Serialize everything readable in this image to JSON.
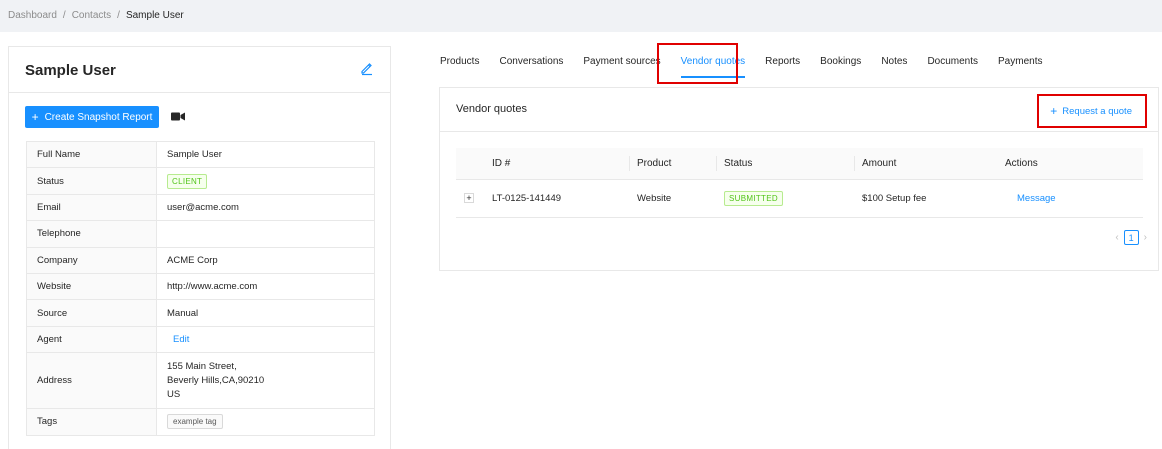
{
  "breadcrumb": {
    "items": [
      "Dashboard",
      "Contacts"
    ],
    "current": "Sample User",
    "separator": "/"
  },
  "profile": {
    "name": "Sample User",
    "snapshot_button": "Create Snapshot Report",
    "rows": {
      "full_name": {
        "label": "Full Name",
        "value": "Sample User"
      },
      "status": {
        "label": "Status",
        "value": "CLIENT"
      },
      "email": {
        "label": "Email",
        "value": "user@acme.com"
      },
      "telephone": {
        "label": "Telephone",
        "value": ""
      },
      "company": {
        "label": "Company",
        "value": "ACME Corp"
      },
      "website": {
        "label": "Website",
        "value": "http://www.acme.com"
      },
      "source": {
        "label": "Source",
        "value": "Manual"
      },
      "agent": {
        "label": "Agent",
        "value": "Edit"
      },
      "address": {
        "label": "Address",
        "line1": "155 Main Street,",
        "line2": "Beverly Hills,CA,90210",
        "line3": "US"
      },
      "tags": {
        "label": "Tags",
        "value": "example tag"
      }
    }
  },
  "tabs": [
    {
      "label": "Products",
      "active": false
    },
    {
      "label": "Conversations",
      "active": false
    },
    {
      "label": "Payment sources",
      "active": false
    },
    {
      "label": "Vendor quotes",
      "active": true
    },
    {
      "label": "Reports",
      "active": false
    },
    {
      "label": "Bookings",
      "active": false
    },
    {
      "label": "Notes",
      "active": false
    },
    {
      "label": "Documents",
      "active": false
    },
    {
      "label": "Payments",
      "active": false
    }
  ],
  "vendor_quotes": {
    "title": "Vendor quotes",
    "request_button": "Request a quote",
    "columns": {
      "id": "ID #",
      "product": "Product",
      "status": "Status",
      "amount": "Amount",
      "actions": "Actions"
    },
    "rows": [
      {
        "id": "LT-0125-141449",
        "product": "Website",
        "status": "SUBMITTED",
        "amount": "$100 Setup fee",
        "action": "Message"
      }
    ],
    "pagination": {
      "current_page": "1",
      "prev": "‹",
      "next": "›"
    }
  },
  "colors": {
    "accent": "#1890ff",
    "success": "#52c41a",
    "highlight_box": "#e00000"
  },
  "icons": {
    "edit": "pencil-icon",
    "video": "video-camera-icon",
    "plus": "plus-icon",
    "expand": "expand-row-icon"
  }
}
